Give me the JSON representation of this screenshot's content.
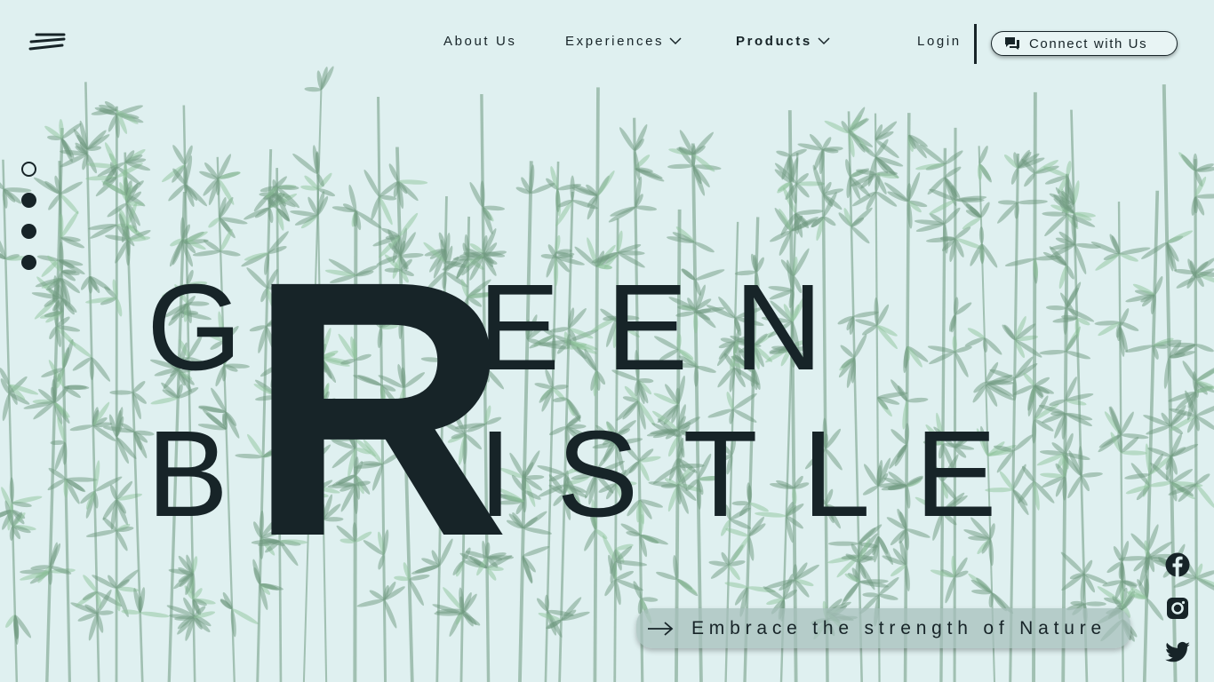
{
  "nav": {
    "about": "About Us",
    "experiences": "Experiences",
    "products": "Products",
    "login": "Login",
    "connect": "Connect with Us"
  },
  "hero": {
    "big_letter": "R",
    "line1_start": "G",
    "line1_end": "EEN",
    "line2_start": "B",
    "line2_end": "ISTLE",
    "cta": "Embrace the strength of Nature"
  },
  "slider": {
    "total": 4,
    "active": 1
  },
  "social": [
    "facebook-icon",
    "instagram-icon",
    "twitter-icon"
  ],
  "colors": {
    "background": "#dff0f0",
    "text": "#172428",
    "bamboo": "#6f9a80"
  }
}
